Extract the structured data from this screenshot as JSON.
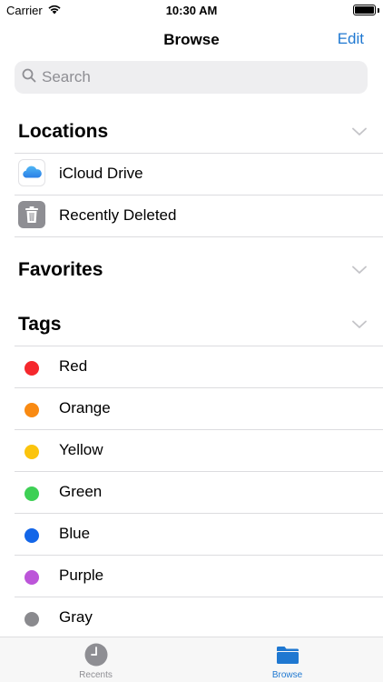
{
  "status_bar": {
    "carrier": "Carrier",
    "time": "10:30 AM"
  },
  "nav": {
    "title": "Browse",
    "edit_label": "Edit"
  },
  "search": {
    "placeholder": "Search",
    "value": ""
  },
  "sections": {
    "locations": {
      "title": "Locations",
      "items": [
        {
          "label": "iCloud Drive",
          "icon": "icloud-icon"
        },
        {
          "label": "Recently Deleted",
          "icon": "trash-icon"
        }
      ]
    },
    "favorites": {
      "title": "Favorites"
    },
    "tags": {
      "title": "Tags",
      "items": [
        {
          "label": "Red",
          "color": "#f5282d"
        },
        {
          "label": "Orange",
          "color": "#f98a12"
        },
        {
          "label": "Yellow",
          "color": "#fbc40d"
        },
        {
          "label": "Green",
          "color": "#3ed055"
        },
        {
          "label": "Blue",
          "color": "#1366e8"
        },
        {
          "label": "Purple",
          "color": "#bc55d9"
        },
        {
          "label": "Gray",
          "color": "#8a8a8e"
        }
      ]
    }
  },
  "tab_bar": {
    "recents_label": "Recents",
    "browse_label": "Browse",
    "active": "browse"
  },
  "colors": {
    "accent": "#1f78d1",
    "inactive": "#8e8e93"
  }
}
